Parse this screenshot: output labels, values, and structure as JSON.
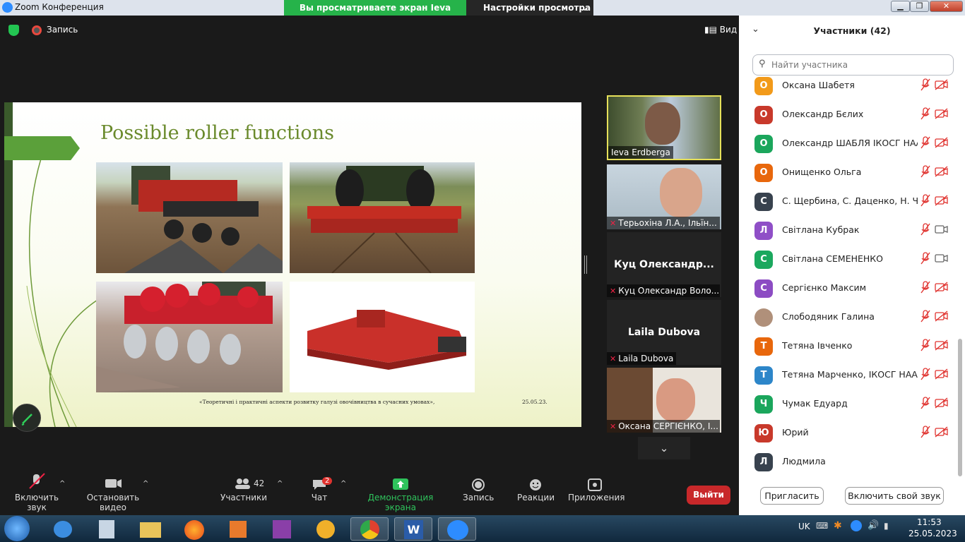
{
  "window": {
    "title": "Zoom Конференция",
    "minimize": "▁",
    "maximize": "❐",
    "close": "✕"
  },
  "share_banner": "Вы просматриваете экран Ieva Erdberga",
  "view_options": "Настройки просмотра",
  "top": {
    "record_label": "Запись",
    "view_label": "Вид"
  },
  "slide": {
    "title": "Possible roller functions",
    "footer_text": "«Теоретичні і практичні аспекти розвитку галузі овочівництва в  сучасних умовах»,",
    "footer_date": "25.05.23."
  },
  "videos": [
    {
      "name": "Ieva Erdberga"
    },
    {
      "name": "Терьохіна Л.А., Ільїн..."
    },
    {
      "big": "Куц  Олександр...",
      "name": "Куц Олександр Воло..."
    },
    {
      "big": "Laila Dubova",
      "name": "Laila Dubova"
    },
    {
      "name": "Оксана СЕРГІЄНКО, І..."
    }
  ],
  "toolbar": {
    "mute": "Включить звук",
    "video": "Остановить видео",
    "participants": "Участники",
    "participants_count": "42",
    "chat": "Чат",
    "chat_badge": "2",
    "share": "Демонстрация экрана",
    "record": "Запись",
    "reactions": "Реакции",
    "apps": "Приложения",
    "leave": "Выйти"
  },
  "panel": {
    "header": "Участники (42)",
    "search_placeholder": "Найти участника",
    "invite": "Пригласить",
    "unmute_me": "Включить свой звук",
    "participants": [
      {
        "initial": "О",
        "name": "Оксана Шабетя",
        "color": "#f29a1a",
        "mic": "muted",
        "cam": "off"
      },
      {
        "initial": "О",
        "name": "Олександр Бєлих",
        "color": "#c8392b",
        "mic": "muted",
        "cam": "off"
      },
      {
        "initial": "О",
        "name": "Олександр ШАБЛЯ ІКОСГ НААН",
        "color": "#1ba65c",
        "mic": "muted",
        "cam": "off"
      },
      {
        "initial": "О",
        "name": "Онищенко Ольга",
        "color": "#e8670c",
        "mic": "muted",
        "cam": "off"
      },
      {
        "initial": "С",
        "name": "С. Щербина, С. Даценко, Н. Ч...",
        "color": "#38424e",
        "mic": "muted",
        "cam": "off"
      },
      {
        "initial": "Л",
        "name": "Світлана Кубрак",
        "color": "#8f4fc7",
        "mic": "muted",
        "cam": "on"
      },
      {
        "initial": "С",
        "name": "Світлана СЕМЕНЕНКО",
        "color": "#1ba85e",
        "mic": "muted",
        "cam": "on"
      },
      {
        "initial": "С",
        "name": "Сергієнко Максим",
        "color": "#8c4cc3",
        "mic": "muted",
        "cam": "off"
      },
      {
        "initial": "",
        "name": "Слободяник Галина",
        "color": "#b0907a",
        "mic": "muted",
        "cam": "off"
      },
      {
        "initial": "Т",
        "name": "Тетяна Івченко",
        "color": "#e8670c",
        "mic": "muted",
        "cam": "off"
      },
      {
        "initial": "Т",
        "name": "Тетяна Марченко, ІКОСГ НААН",
        "color": "#2d86c9",
        "mic": "muted",
        "cam": "off"
      },
      {
        "initial": "Ч",
        "name": "Чумак Едуард",
        "color": "#1ba65c",
        "mic": "muted",
        "cam": "off"
      },
      {
        "initial": "Ю",
        "name": "Юрий",
        "color": "#c8392b",
        "mic": "muted",
        "cam": "off"
      },
      {
        "initial": "Л",
        "name": "Людмила",
        "color": "#38424e",
        "mic": "none",
        "cam": "none"
      }
    ]
  },
  "taskbar": {
    "lang": "UK",
    "time": "11:53",
    "date": "25.05.2023"
  }
}
